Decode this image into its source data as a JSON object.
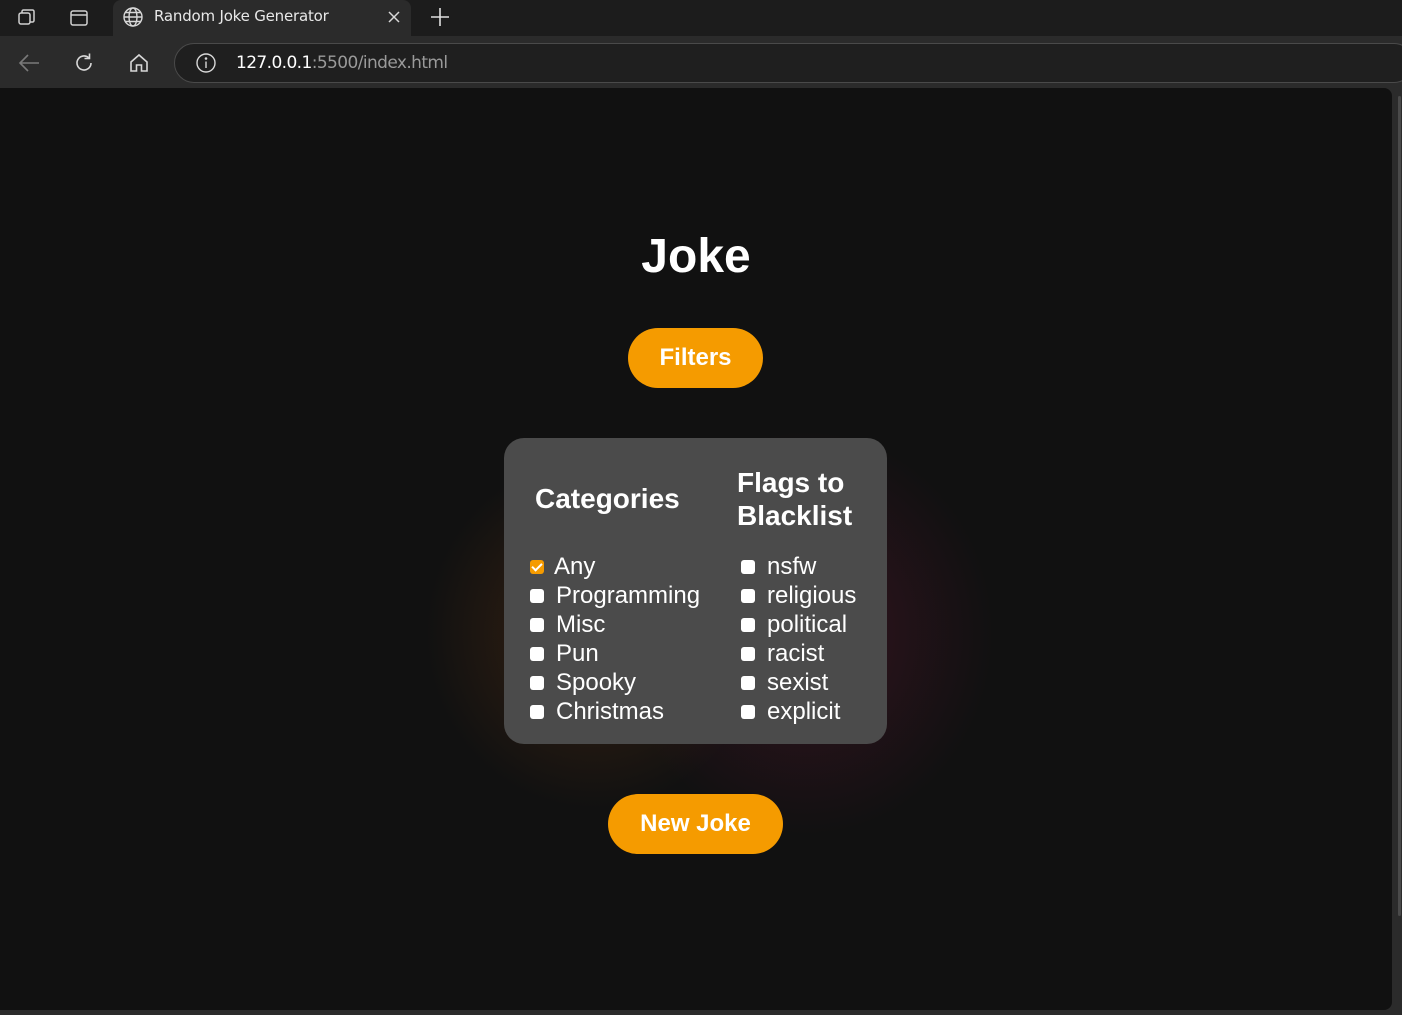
{
  "browser": {
    "tab_title": "Random Joke Generator",
    "url_host": "127.0.0.1",
    "url_rest": ":5500/index.html",
    "icons": {
      "workspaces": "workspaces-icon",
      "tab_actions": "tab-actions-icon",
      "globe": "globe-icon",
      "close": "close-icon",
      "new_tab": "plus-icon",
      "back": "back-arrow-icon",
      "reload": "reload-icon",
      "home": "home-icon",
      "info": "info-icon"
    }
  },
  "page": {
    "title": "Joke",
    "filters_label": "Filters",
    "new_joke_label": "New Joke",
    "categories_heading": "Categories",
    "flags_heading": "Flags to Blacklist",
    "categories": [
      {
        "label": "Any",
        "checked": true
      },
      {
        "label": "Programming",
        "checked": false
      },
      {
        "label": "Misc",
        "checked": false
      },
      {
        "label": "Pun",
        "checked": false
      },
      {
        "label": "Spooky",
        "checked": false
      },
      {
        "label": "Christmas",
        "checked": false
      }
    ],
    "flags": [
      {
        "label": "nsfw",
        "checked": false
      },
      {
        "label": "religious",
        "checked": false
      },
      {
        "label": "political",
        "checked": false
      },
      {
        "label": "racist",
        "checked": false
      },
      {
        "label": "sexist",
        "checked": false
      },
      {
        "label": "explicit",
        "checked": false
      }
    ]
  },
  "colors": {
    "accent": "#f59b00",
    "page_bg": "#111111",
    "panel_bg": "#4b4b4b",
    "chrome_bg": "#2b2b2b"
  }
}
